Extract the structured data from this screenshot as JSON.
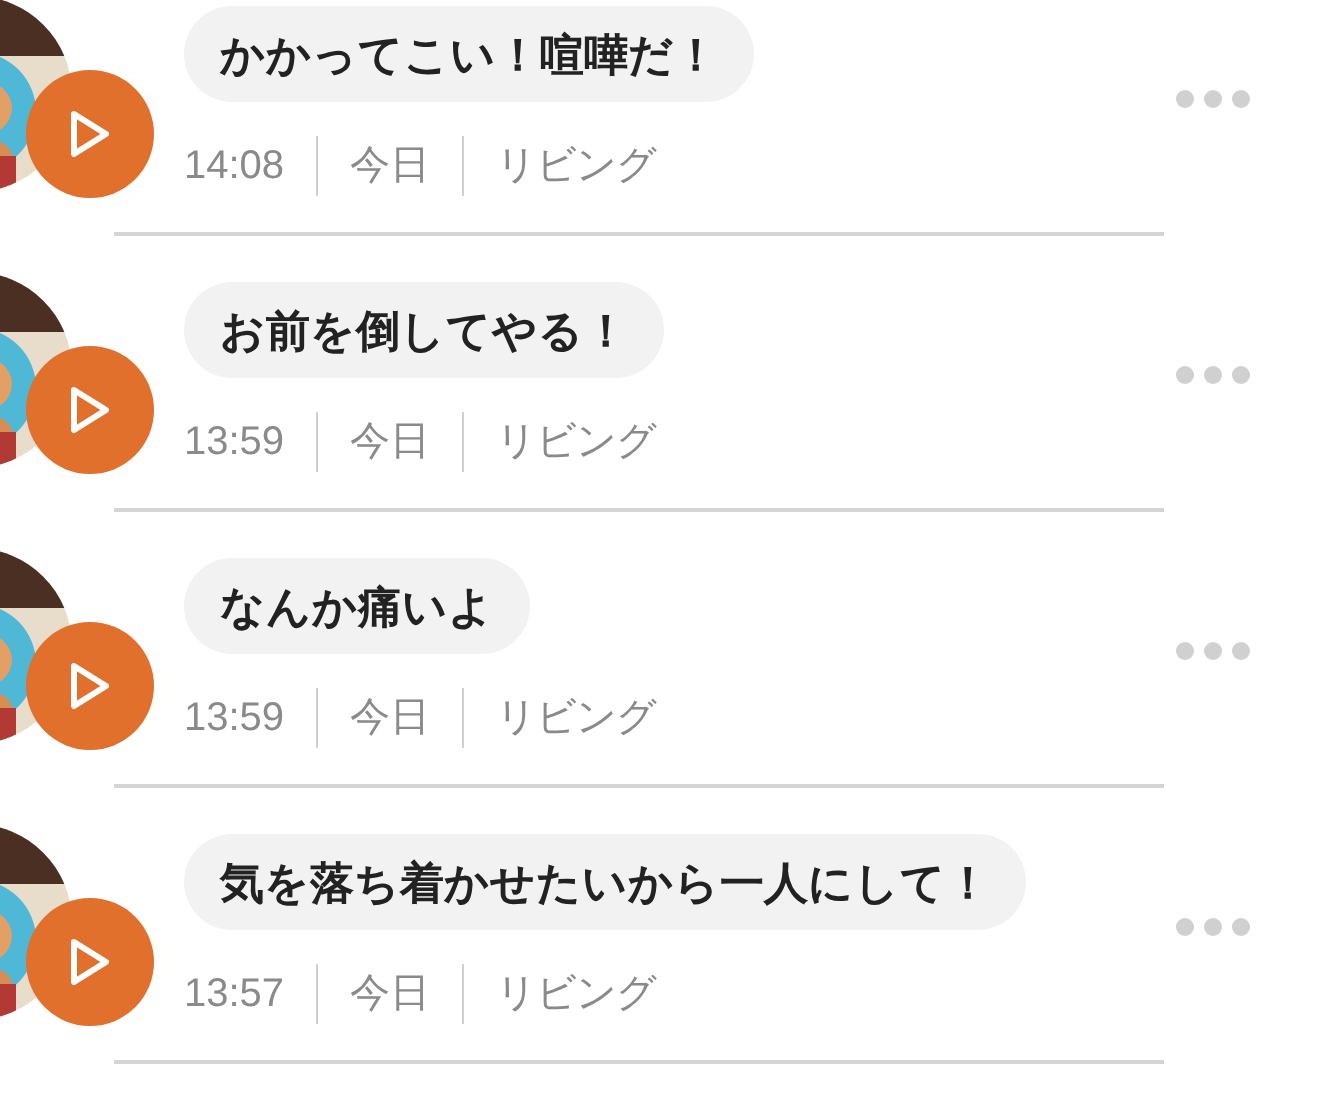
{
  "messages": [
    {
      "text": "かかってこい！喧嘩だ！",
      "time": "14:08",
      "day": "今日",
      "room": "リビング"
    },
    {
      "text": "お前を倒してやる！",
      "time": "13:59",
      "day": "今日",
      "room": "リビング"
    },
    {
      "text": "なんか痛いよ",
      "time": "13:59",
      "day": "今日",
      "room": "リビング"
    },
    {
      "text": "気を落ち着かせたいから一人にして！",
      "time": "13:57",
      "day": "今日",
      "room": "リビング"
    }
  ]
}
